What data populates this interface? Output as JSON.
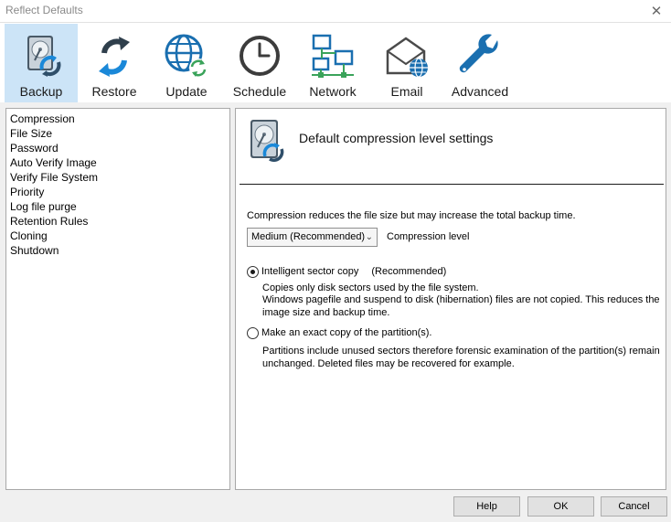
{
  "window": {
    "title": "Reflect Defaults",
    "close_glyph": "✕"
  },
  "toolbar": {
    "items": [
      {
        "label": "Backup",
        "icon": "disk-backup-icon",
        "active": true
      },
      {
        "label": "Restore",
        "icon": "restore-arrows-icon"
      },
      {
        "label": "Update",
        "icon": "globe-update-icon"
      },
      {
        "label": "Schedule",
        "icon": "clock-icon"
      },
      {
        "label": "Network",
        "icon": "network-icon"
      },
      {
        "label": "Email",
        "icon": "envelope-globe-icon"
      },
      {
        "label": "Advanced",
        "icon": "wrench-icon"
      }
    ]
  },
  "sidebar": {
    "items": [
      "Compression",
      "File Size",
      "Password",
      "Auto Verify Image",
      "Verify File System",
      "Priority",
      "Log file purge",
      "Retention Rules",
      "Cloning",
      "Shutdown"
    ]
  },
  "content": {
    "title": "Default compression level settings",
    "description": "Compression reduces the file size but may increase the total backup time.",
    "compression_select": {
      "value": "Medium (Recommended)"
    },
    "compression_label": "Compression level",
    "option1": {
      "label": "Intelligent sector copy",
      "note": "(Recommended)",
      "checked": true,
      "line1": "Copies only disk sectors used by the file system.",
      "line2": "Windows pagefile and suspend to disk (hibernation) files are not copied. This reduces the image size and backup time."
    },
    "option2": {
      "label": "Make an exact copy of the partition(s).",
      "checked": false,
      "text": "Partitions include unused sectors therefore forensic examination of the partition(s) remain unchanged. Deleted files may be recovered for example."
    }
  },
  "buttons": {
    "help": "Help",
    "ok": "OK",
    "cancel": "Cancel"
  },
  "colors": {
    "accent_blue": "#1a88d8",
    "active_tab_bg": "#cce4f7",
    "icon_dark": "#2f4f6a"
  }
}
